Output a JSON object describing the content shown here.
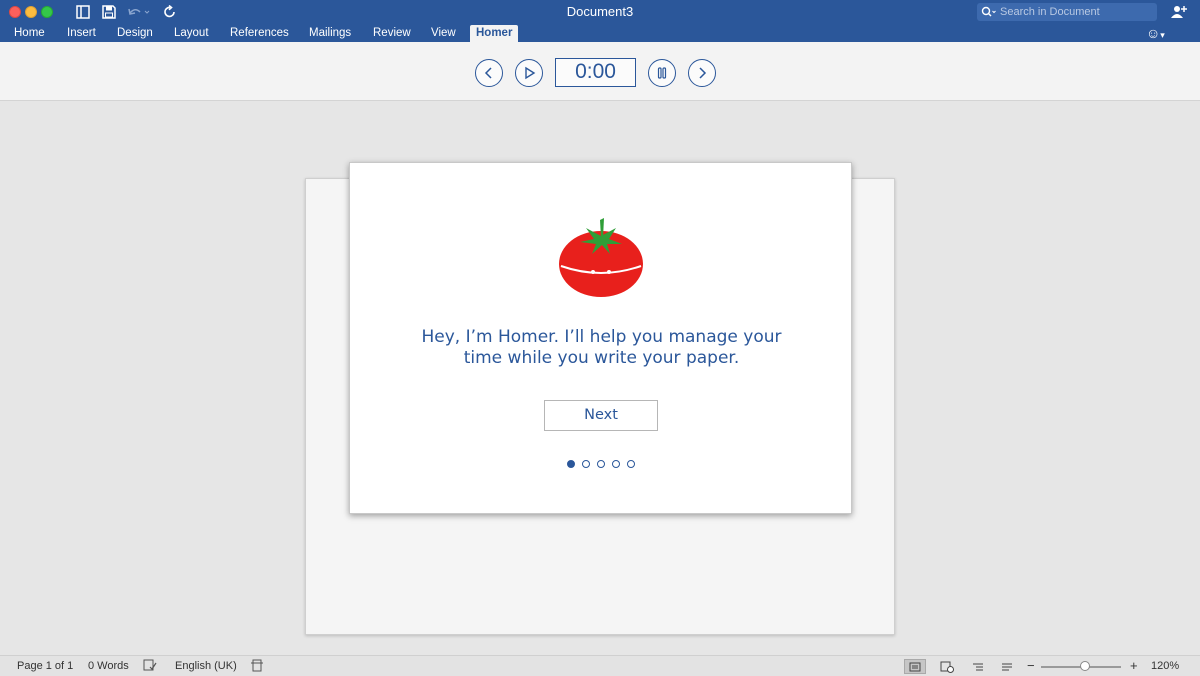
{
  "window": {
    "title": "Document3",
    "search_placeholder": "Search in Document"
  },
  "tabs": [
    {
      "label": "Home"
    },
    {
      "label": "Insert"
    },
    {
      "label": "Design"
    },
    {
      "label": "Layout"
    },
    {
      "label": "References"
    },
    {
      "label": "Mailings"
    },
    {
      "label": "Review"
    },
    {
      "label": "View"
    },
    {
      "label": "Homer",
      "active": true
    }
  ],
  "homer_toolbar": {
    "timer": "0:00",
    "icons": [
      "previous-icon",
      "play-icon",
      "pause-icon",
      "next-icon"
    ]
  },
  "dialog": {
    "line1": "Hey, I’m Homer. I’ll help you manage your",
    "line2": "time while you write your paper.",
    "next_label": "Next",
    "steps_total": 5,
    "current_step": 1
  },
  "status": {
    "page": "Page 1 of 1",
    "words": "0 Words",
    "language": "English (UK)",
    "zoom": "120%",
    "zoom_percent": 120
  },
  "colors": {
    "brand": "#2b579a",
    "tomato": "#e8201c",
    "leaf": "#2f9e38"
  }
}
